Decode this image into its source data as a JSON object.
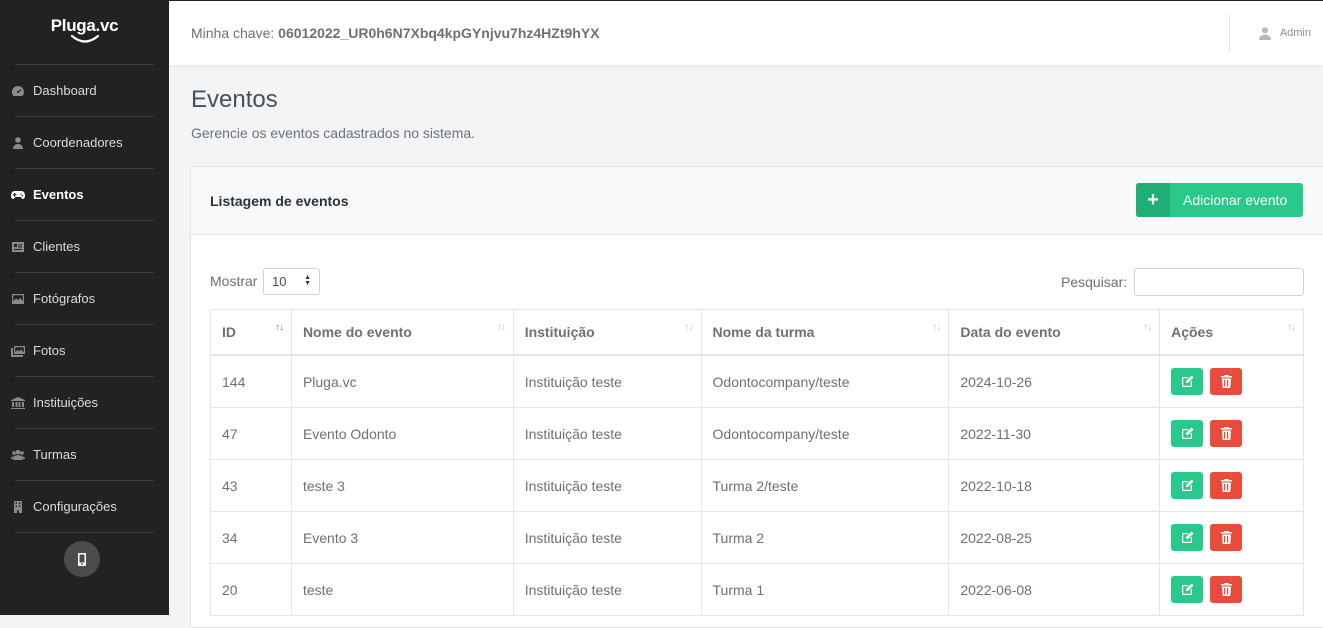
{
  "brand": {
    "name": "Pluga.vc"
  },
  "sidebar": {
    "items": [
      {
        "label": "Dashboard",
        "icon": "dashboard-icon",
        "active": false
      },
      {
        "label": "Coordenadores",
        "icon": "user-icon",
        "active": false
      },
      {
        "label": "Eventos",
        "icon": "gamepad-icon",
        "active": true
      },
      {
        "label": "Clientes",
        "icon": "id-card-icon",
        "active": false
      },
      {
        "label": "Fotógrafos",
        "icon": "image-icon",
        "active": false
      },
      {
        "label": "Fotos",
        "icon": "images-icon",
        "active": false
      },
      {
        "label": "Instituições",
        "icon": "bank-icon",
        "active": false
      },
      {
        "label": "Turmas",
        "icon": "users-icon",
        "active": false
      },
      {
        "label": "Configurações",
        "icon": "building-icon",
        "active": false
      }
    ],
    "mobile_icon": "mobile-icon"
  },
  "topbar": {
    "key_label": "Minha chave:",
    "key_value": "06012022_UR0h6N7Xbq4kpGYnjvu7hz4HZt9hYX",
    "user_name": "Admin"
  },
  "page": {
    "title": "Eventos",
    "subtitle": "Gerencie os eventos cadastrados no sistema."
  },
  "card": {
    "title": "Listagem de eventos",
    "add_button": "Adicionar evento",
    "show_label": "Mostrar",
    "show_value": "10",
    "search_label": "Pesquisar:"
  },
  "table": {
    "columns": [
      "ID",
      "Nome do evento",
      "Instituição",
      "Nome da turma",
      "Data do evento",
      "Ações"
    ],
    "rows": [
      [
        "144",
        "Pluga.vc",
        "Instituição teste",
        "Odontocompany/teste",
        "2024-10-26"
      ],
      [
        "47",
        "Evento Odonto",
        "Instituição teste",
        "Odontocompany/teste",
        "2022-11-30"
      ],
      [
        "43",
        "teste 3",
        "Instituição teste",
        "Turma 2/teste",
        "2022-10-18"
      ],
      [
        "34",
        "Evento 3",
        "Instituição teste",
        "Turma 2",
        "2022-08-25"
      ],
      [
        "20",
        "teste",
        "Instituição teste",
        "Turma 1",
        "2022-06-08"
      ]
    ]
  },
  "colors": {
    "sidebar_bg": "#222222",
    "accent_green": "#28c98a",
    "danger_red": "#e74c3c"
  }
}
